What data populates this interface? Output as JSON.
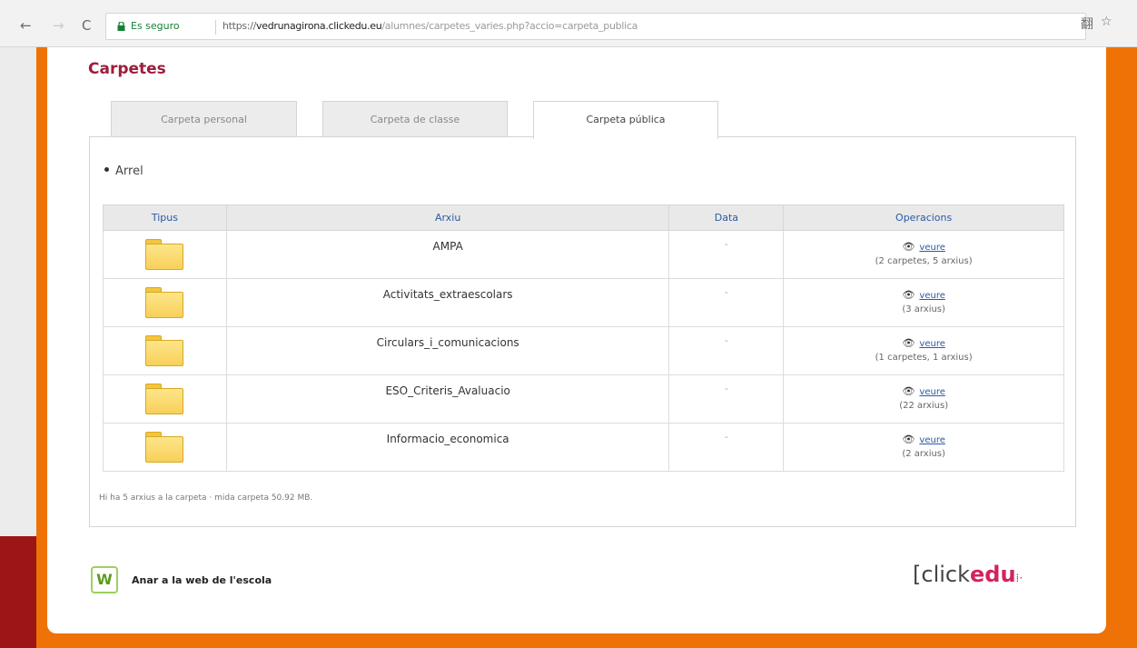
{
  "browser": {
    "back_icon": "←",
    "forward_icon": "→",
    "reload_icon": "C",
    "secure_label": "Es seguro",
    "url_scheme": "https://",
    "url_host": "vedrunagirona.clickedu.eu",
    "url_path": "/alumnes/carpetes_varies.php?accio=carpeta_publica",
    "translate_icon": "翻",
    "star_icon": "☆"
  },
  "page": {
    "title": "Carpetes"
  },
  "tabs": [
    {
      "label": "Carpeta personal"
    },
    {
      "label": "Carpeta de classe"
    },
    {
      "label": "Carpeta pública"
    }
  ],
  "breadcrumb": {
    "label": "Arrel"
  },
  "table": {
    "headers": [
      "Tipus",
      "Arxiu",
      "Data",
      "Operacions"
    ],
    "rows": [
      {
        "name": "AMPA",
        "date": "-",
        "op_label": "veure",
        "op_count": "(2 carpetes, 5 arxius)"
      },
      {
        "name": "Activitats_extraescolars",
        "date": "-",
        "op_label": "veure",
        "op_count": "(3 arxius)"
      },
      {
        "name": "Circulars_i_comunicacions",
        "date": "-",
        "op_label": "veure",
        "op_count": "(1 carpetes, 1 arxius)"
      },
      {
        "name": "ESO_Criteris_Avaluacio",
        "date": "-",
        "op_label": "veure",
        "op_count": "(22 arxius)"
      },
      {
        "name": "Informacio_economica",
        "date": "-",
        "op_label": "veure",
        "op_count": "(2 arxius)"
      }
    ]
  },
  "summary": "Hi ha 5 arxius a la carpeta · mida carpeta 50.92 MB.",
  "footer": {
    "w_logo": "W",
    "link_label": "Anar a la web de l'escola",
    "brand_bracket": "[",
    "brand_click": "click",
    "brand_edu": "edu",
    "brand_dots": "⁞·"
  },
  "colors": {
    "orange_bg": "#ee7205",
    "title_crimson": "#9d1d3d",
    "link_blue": "#2a5aa5",
    "brand_pink": "#d2235a"
  }
}
